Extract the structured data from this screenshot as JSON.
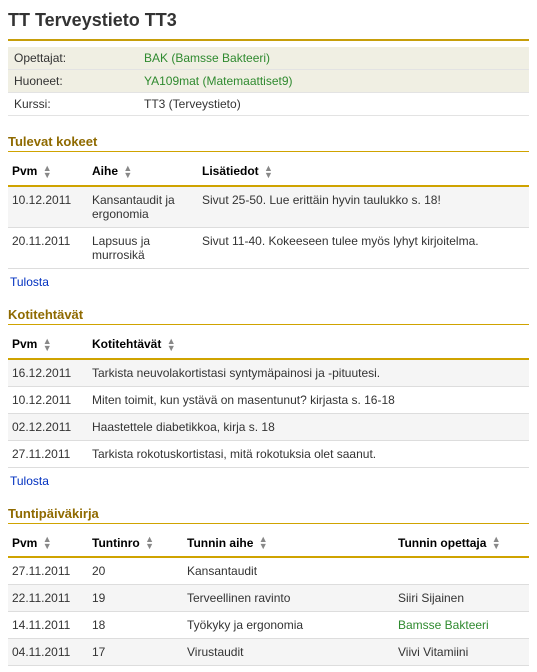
{
  "page_title": "TT Terveystieto TT3",
  "info": {
    "rows": [
      {
        "label": "Opettajat:",
        "value": "BAK (Bamsse Bakteeri)",
        "link": true
      },
      {
        "label": "Huoneet:",
        "value": "YA109mat (Matemaattiset9)",
        "link": true
      },
      {
        "label": "Kurssi:",
        "value": "TT3 (Terveystieto)",
        "link": false
      }
    ]
  },
  "exams": {
    "title": "Tulevat kokeet",
    "headers": {
      "pvm": "Pvm",
      "aihe": "Aihe",
      "lisatiedot": "Lisätiedot"
    },
    "rows": [
      {
        "pvm": "10.12.2011",
        "aihe": "Kansantaudit ja ergonomia",
        "lisa": "Sivut 25-50. Lue erittäin hyvin taulukko s. 18!"
      },
      {
        "pvm": "20.11.2011",
        "aihe": "Lapsuus ja murrosikä",
        "lisa": "Sivut 11-40. Kokeeseen tulee myös lyhyt kirjoitelma."
      }
    ],
    "print": "Tulosta"
  },
  "homework": {
    "title": "Kotitehtävät",
    "headers": {
      "pvm": "Pvm",
      "task": "Kotitehtävät"
    },
    "rows": [
      {
        "pvm": "16.12.2011",
        "task": "Tarkista neuvolakortistasi syntymäpainosi ja -pituutesi."
      },
      {
        "pvm": "10.12.2011",
        "task": "Miten toimit, kun ystävä on masentunut? kirjasta s. 16-18"
      },
      {
        "pvm": "02.12.2011",
        "task": " Haastettele diabetikkoa, kirja s. 18"
      },
      {
        "pvm": "27.11.2011",
        "task": "Tarkista rokotuskortistasi, mitä rokotuksia olet saanut."
      }
    ],
    "print": "Tulosta"
  },
  "diary": {
    "title": "Tuntipäiväkirja",
    "headers": {
      "pvm": "Pvm",
      "nro": "Tuntinro",
      "aihe": "Tunnin aihe",
      "opettaja": "Tunnin opettaja"
    },
    "rows": [
      {
        "pvm": "27.11.2011",
        "nro": "20",
        "aihe": "Kansantaudit",
        "opettaja": "",
        "link": false
      },
      {
        "pvm": "22.11.2011",
        "nro": "19",
        "aihe": "Terveellinen ravinto",
        "opettaja": "Siiri Sijainen",
        "link": false
      },
      {
        "pvm": "14.11.2011",
        "nro": "18",
        "aihe": "Työkyky ja ergonomia",
        "opettaja": "Bamsse Bakteeri",
        "link": true
      },
      {
        "pvm": "04.11.2011",
        "nro": "17",
        "aihe": "Virustaudit",
        "opettaja": "Viivi Vitamiini",
        "link": false
      }
    ]
  }
}
